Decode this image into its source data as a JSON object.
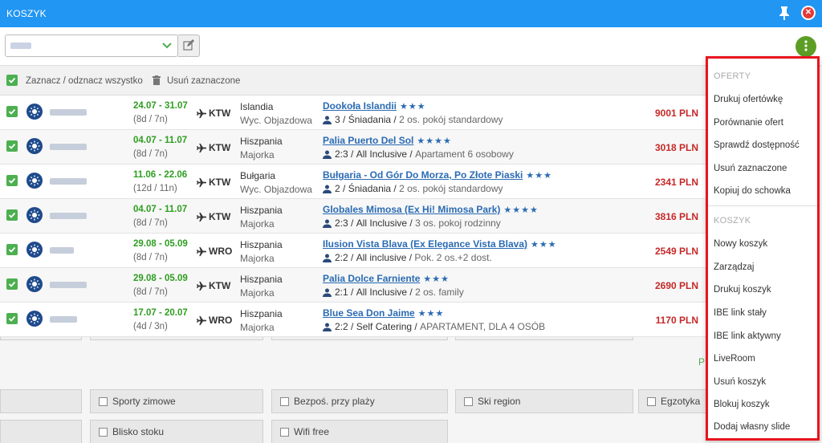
{
  "window": {
    "title": "KOSZYK"
  },
  "toolbar": {
    "basket_value": ""
  },
  "selection": {
    "select_all_label": "Zaznacz / odznacz wszystko",
    "delete_selected_label": "Usuń zaznaczone"
  },
  "offers": [
    {
      "date": "24.07 - 31.07",
      "nights": "(8d / 7n)",
      "airport": "KTW",
      "country": "Islandia",
      "region": "Wyc. Objazdowa",
      "hotel": "Dookoła Islandii",
      "stars": "★★★",
      "persons": "3",
      "board": "Śniadania",
      "room": "2 os. pokój standardowy",
      "price": "9001 PLN"
    },
    {
      "date": "04.07 - 11.07",
      "nights": "(8d / 7n)",
      "airport": "KTW",
      "country": "Hiszpania",
      "region": "Majorka",
      "hotel": "Palia Puerto Del Sol",
      "stars": "★★★★",
      "persons": "2:3",
      "board": "All Inclusive",
      "room": "Apartament 6 osobowy",
      "price": "3018 PLN"
    },
    {
      "date": "11.06 - 22.06",
      "nights": "(12d / 11n)",
      "airport": "KTW",
      "country": "Bułgaria",
      "region": "Wyc. Objazdowa",
      "hotel": "Bułgaria - Od Gór Do Morza, Po Złote Piaski",
      "stars": "★★★",
      "persons": "2",
      "board": "Śniadania",
      "room": "2 os. pokój standardowy",
      "price": "2341 PLN"
    },
    {
      "date": "04.07 - 11.07",
      "nights": "(8d / 7n)",
      "airport": "KTW",
      "country": "Hiszpania",
      "region": "Majorka",
      "hotel": "Globales Mimosa (Ex Hi! Mimosa Park)",
      "stars": "★★★★",
      "persons": "2:3",
      "board": "All Inclusive",
      "room": "3 os. pokoj rodzinny",
      "price": "3816 PLN"
    },
    {
      "date": "29.08 - 05.09",
      "nights": "(8d / 7n)",
      "airport": "WRO",
      "country": "Hiszpania",
      "region": "Majorka",
      "hotel": "Ilusion Vista Blava (Ex Elegance Vista Blava)",
      "stars": "★★★",
      "persons": "2:2",
      "board": "All inclusive",
      "room": "Pok. 2 os.+2 dost.",
      "price": "2549 PLN"
    },
    {
      "date": "29.08 - 05.09",
      "nights": "(8d / 7n)",
      "airport": "KTW",
      "country": "Hiszpania",
      "region": "Majorka",
      "hotel": "Palia Dolce Farniente",
      "stars": "★★★",
      "persons": "2:1",
      "board": "All Inclusive",
      "room": "2 os. family",
      "price": "2690 PLN"
    },
    {
      "date": "17.07 - 20.07",
      "nights": "(4d / 3n)",
      "airport": "WRO",
      "country": "Hiszpania",
      "region": "Majorka",
      "hotel": "Blue Sea Don Jaime",
      "stars": "★★★",
      "persons": "2:2",
      "board": "Self Catering",
      "room": "APARTAMENT, DLA 4 OSÓB",
      "price": "1170 PLN"
    }
  ],
  "filters": {
    "row1": [
      "Sporty zimowe",
      "Bezpoś. przy plaży",
      "Ski region",
      "Egzotyka"
    ],
    "row2": [
      "Blisko stoku",
      "Wifi free"
    ]
  },
  "menu": {
    "offers_section": "OFERTY",
    "offers_items": [
      "Drukuj ofertówkę",
      "Porównanie ofert",
      "Sprawdź dostępność",
      "Usuń zaznaczone",
      "Kopiuj do schowka"
    ],
    "basket_section": "KOSZYK",
    "basket_items": [
      "Nowy koszyk",
      "Zarządzaj",
      "Drukuj koszyk",
      "IBE link stały",
      "IBE link aktywny",
      "LiveRoom",
      "Usuń koszyk",
      "Blokuj koszyk",
      "Dodaj własny slide"
    ]
  },
  "colors": {
    "titlebar": "#2196f3",
    "accent_green": "#4caf50",
    "price_red": "#c62828",
    "link_blue": "#2a6bb3",
    "menu_border": "#e8141f"
  }
}
